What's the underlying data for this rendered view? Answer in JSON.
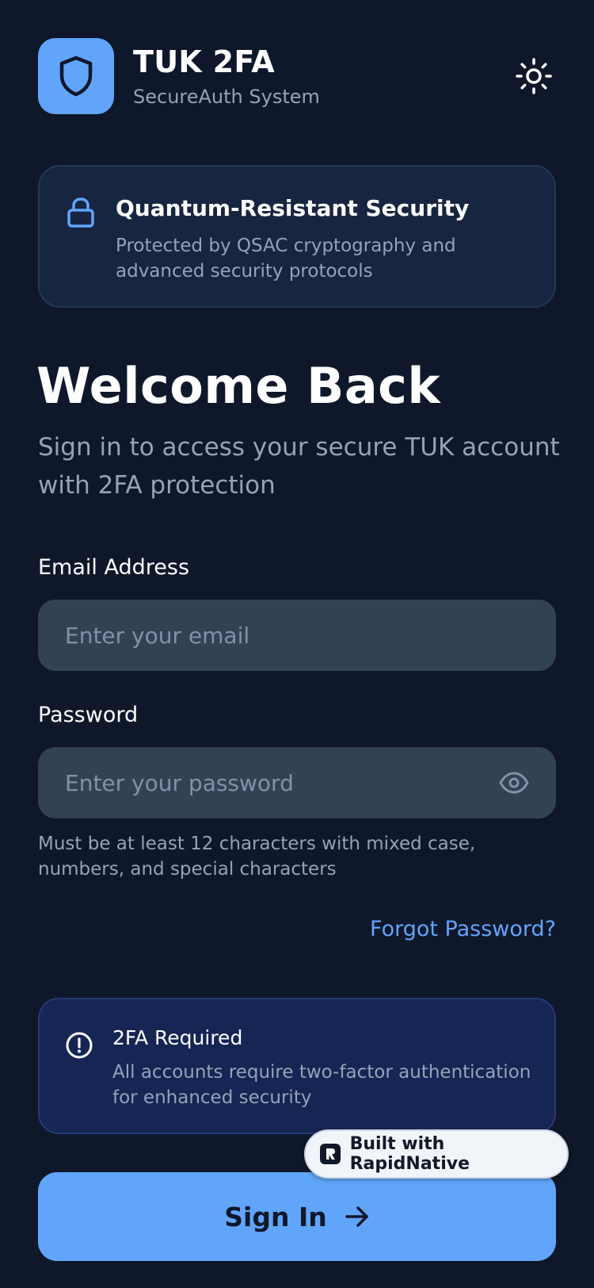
{
  "header": {
    "title": "TUK 2FA",
    "subtitle": "SecureAuth System",
    "logo_icon": "shield-icon",
    "theme_icon": "sun-icon"
  },
  "security_card": {
    "icon": "lock-icon",
    "title": "Quantum-Resistant Security",
    "text": "Protected by QSAC cryptography and advanced security protocols"
  },
  "welcome": {
    "title": "Welcome Back",
    "subtitle": "Sign in to access your secure TUK account with 2FA protection"
  },
  "form": {
    "email_label": "Email Address",
    "email_placeholder": "Enter your email",
    "email_value": "",
    "password_label": "Password",
    "password_placeholder": "Enter your password",
    "password_value": "",
    "password_toggle_icon": "eye-icon",
    "password_hint": "Must be at least 12 characters with mixed case, numbers, and special characters",
    "forgot_link": "Forgot Password?"
  },
  "tfa_notice": {
    "icon": "alert-circle-icon",
    "title": "2FA Required",
    "text": "All accounts require two-factor authentication for enhanced security"
  },
  "badge": {
    "text": "Built with RapidNative"
  },
  "signin": {
    "label": "Sign In",
    "icon": "arrow-right-icon"
  },
  "colors": {
    "background": "#0f172a",
    "accent": "#60a5fa",
    "card": "#172540",
    "notice_card": "#172554",
    "input": "#334155",
    "muted_text": "#94a3b8"
  }
}
